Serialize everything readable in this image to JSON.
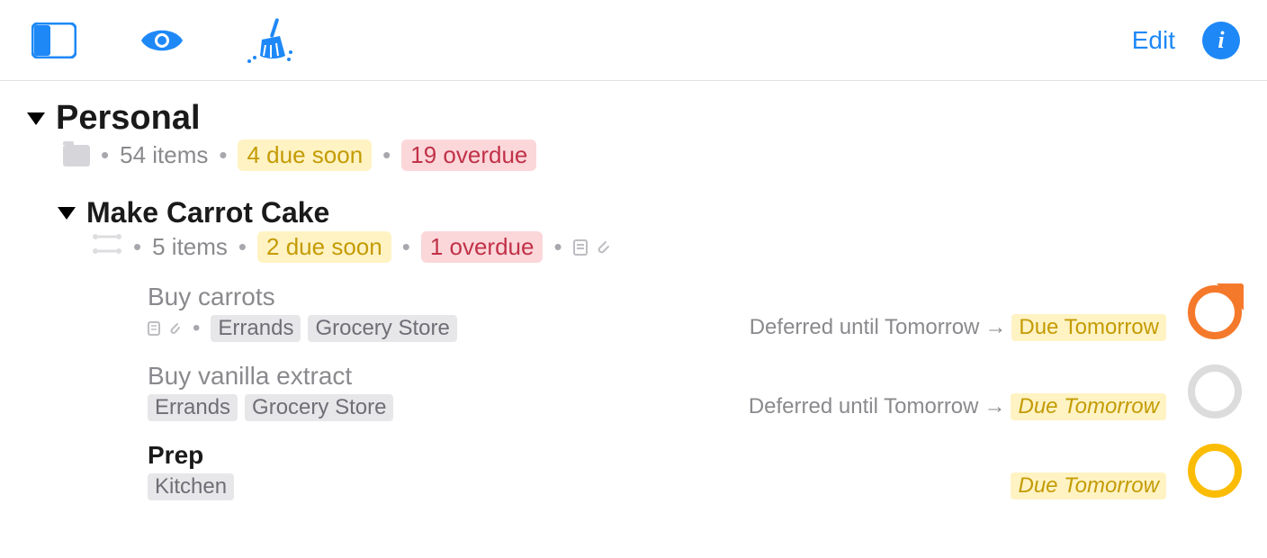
{
  "toolbar": {
    "edit_label": "Edit",
    "info_glyph": "i"
  },
  "folder": {
    "title": "Personal",
    "items_text": "54 items",
    "due_soon_text": "4 due soon",
    "overdue_text": "19 overdue"
  },
  "project": {
    "title": "Make Carrot Cake",
    "items_text": "5 items",
    "due_soon_text": "2 due soon",
    "overdue_text": "1 overdue"
  },
  "tasks": [
    {
      "title": "Buy carrots",
      "tags": [
        "Errands",
        "Grocery Store"
      ],
      "defer": "Deferred until Tomorrow",
      "due": "Due Tomorrow",
      "has_note": true,
      "has_attach": true,
      "dim": true,
      "due_italic": false,
      "status": "orange"
    },
    {
      "title": "Buy vanilla extract",
      "tags": [
        "Errands",
        "Grocery Store"
      ],
      "defer": "Deferred until Tomorrow",
      "due": "Due Tomorrow",
      "has_note": false,
      "has_attach": false,
      "dim": true,
      "due_italic": true,
      "status": "gray"
    },
    {
      "title": "Prep",
      "tags": [
        "Kitchen"
      ],
      "defer": "",
      "due": "Due Tomorrow",
      "has_note": false,
      "has_attach": false,
      "dim": false,
      "due_italic": true,
      "status": "amber"
    }
  ]
}
